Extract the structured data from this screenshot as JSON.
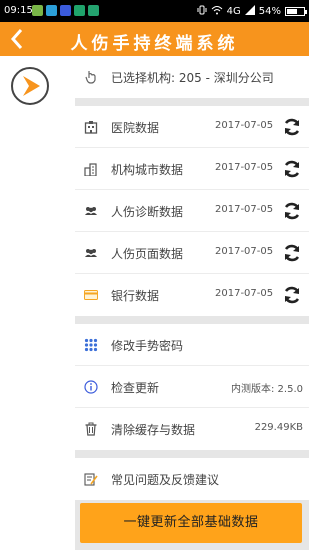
{
  "status_bar": {
    "time": "09:15",
    "network": "4G",
    "battery": "54%",
    "battery_level": 0.54,
    "app_icon_colors": [
      "#7ab648",
      "#2b9fd8",
      "#3b5bdb",
      "#1fa36b",
      "#24a36f"
    ]
  },
  "header": {
    "title": "人伤手持终端系统",
    "back_icon": "chevron-left-icon"
  },
  "colors": {
    "brand": "#f7941d",
    "button": "#ffa31a"
  },
  "org": {
    "label": "已选择机构: 205 - 深圳分公司",
    "icon": "pointer-hand-icon"
  },
  "data_rows": [
    {
      "label": "医院数据",
      "date": "2017-07-05",
      "icon": "hospital-icon"
    },
    {
      "label": "机构城市数据",
      "date": "2017-07-05",
      "icon": "city-buildings-icon"
    },
    {
      "label": "人伤诊断数据",
      "date": "2017-07-05",
      "icon": "people-icon"
    },
    {
      "label": "人伤页面数据",
      "date": "2017-07-05",
      "icon": "people-icon"
    },
    {
      "label": "银行数据",
      "date": "2017-07-05",
      "icon": "bank-card-icon"
    }
  ],
  "settings": {
    "change_pattern": "修改手势密码",
    "check_update": "检查更新",
    "version": "内测版本: 2.5.0",
    "clear_cache": "清除缓存与数据",
    "cache_size": "229.49KB",
    "faq": "常见问题及反馈建议"
  },
  "update_all_button": "一键更新全部基础数据"
}
